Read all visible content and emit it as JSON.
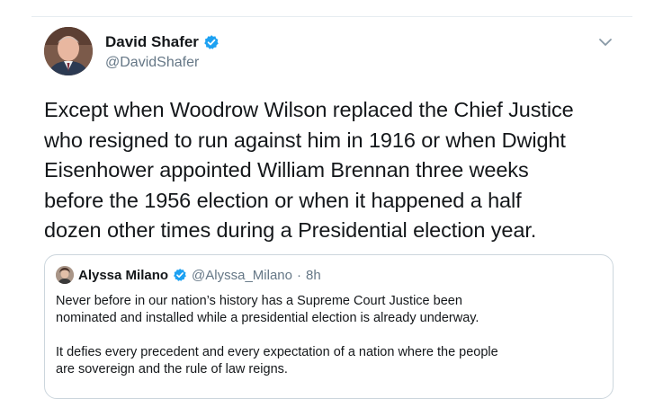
{
  "tweet": {
    "author": {
      "name": "David Shafer",
      "handle": "@DavidShafer",
      "verified": true
    },
    "text_lines": [
      "Except when Woodrow Wilson replaced the Chief Justice",
      "who resigned to run against him in 1916 or when Dwight",
      "Eisenhower appointed William Brennan three weeks",
      "before the 1956 election or when it happened a half",
      "dozen other times during a Presidential election year."
    ],
    "menu_icon": "chevron-down-icon",
    "colors": {
      "verified": "#1da1f2",
      "secondary_text": "#657786",
      "primary_text": "#14171a",
      "border": "#ccd6dd"
    }
  },
  "quote": {
    "author": {
      "name": "Alyssa Milano",
      "handle": "@Alyssa_Milano",
      "separator": "·",
      "time": "8h",
      "verified": true
    },
    "paragraph1_lines": [
      "Never before in our nation’s history has a Supreme Court Justice been",
      "nominated and installed while a presidential election is already underway."
    ],
    "paragraph2_lines": [
      "It defies every precedent and every expectation of a nation where the people",
      "are sovereign and the rule of law reigns."
    ]
  }
}
